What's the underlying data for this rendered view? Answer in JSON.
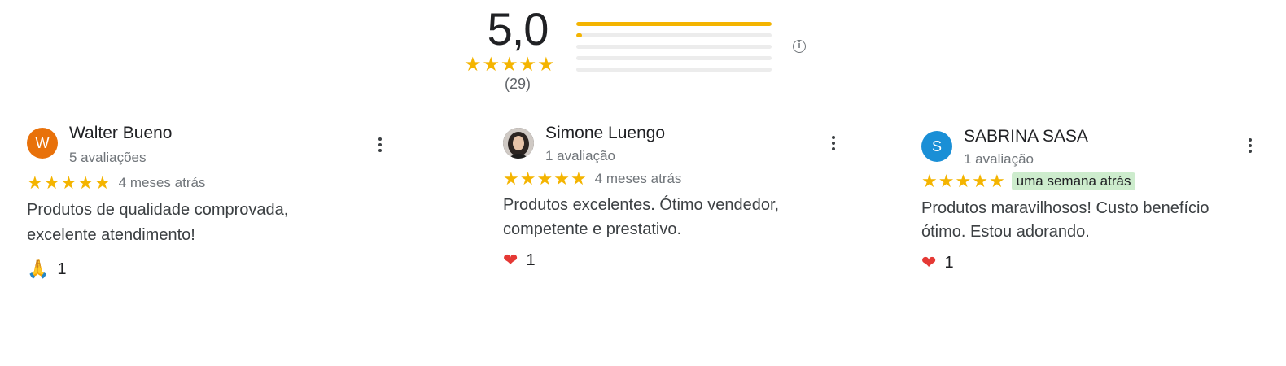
{
  "summary": {
    "score": "5,0",
    "count": "(29)",
    "distribution": [
      1.0,
      0.03,
      0,
      0,
      0
    ],
    "star_color": "#f4b400"
  },
  "reviews": [
    {
      "initial": "W",
      "avatar_color": "#e8710a",
      "name": "Walter Bueno",
      "reviews_count": "5 avaliações",
      "time": "4 meses atrás",
      "text": "Produtos de qualidade comprovada, excelente atendimento!",
      "reaction_icon": "🙏",
      "reaction_count": "1"
    },
    {
      "initial": "",
      "avatar_color": "#3a3a3a",
      "name": "Simone Luengo",
      "reviews_count": "1 avaliação",
      "time": "4 meses atrás",
      "text": "Produtos excelentes. Ótimo vendedor, competente e prestativo.",
      "reaction_icon": "❤",
      "reaction_count": "1"
    },
    {
      "initial": "S",
      "avatar_color": "#1a8fd6",
      "name": "SABRINA SASA",
      "reviews_count": "1 avaliação",
      "time": "uma semana atrás",
      "text": "Produtos maravilhosos! Custo benefício ótimo. Estou adorando.",
      "reaction_icon": "❤",
      "reaction_count": "1"
    }
  ]
}
